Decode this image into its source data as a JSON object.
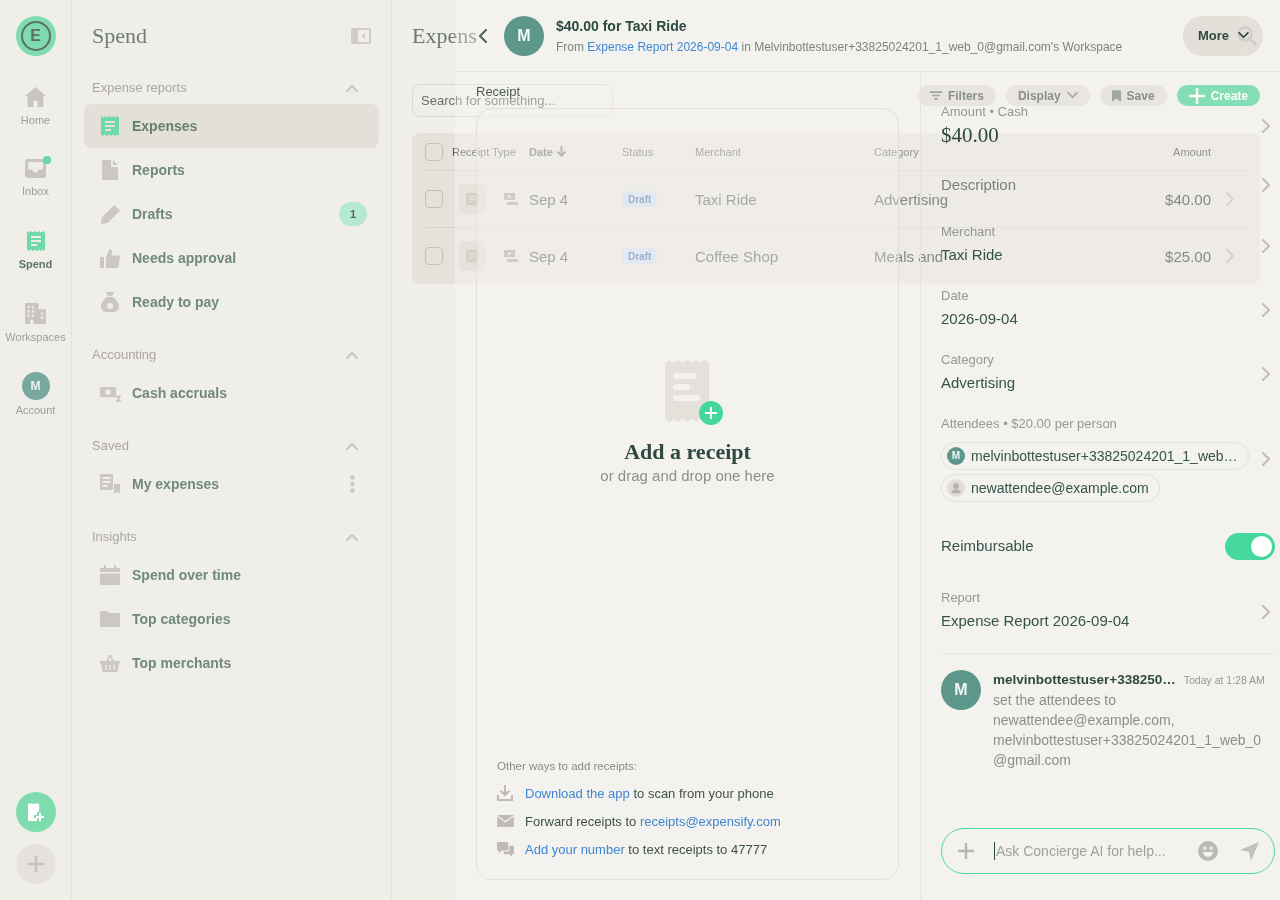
{
  "nav_rail": {
    "logo": "E",
    "items": [
      {
        "label": "Home",
        "selected": false,
        "notification": false
      },
      {
        "label": "Inbox",
        "selected": false,
        "notification": true
      },
      {
        "label": "Spend",
        "selected": true,
        "notification": false
      },
      {
        "label": "Workspaces",
        "selected": false,
        "notification": false
      },
      {
        "label": "Account",
        "selected": false,
        "notification": false,
        "avatar": "M"
      }
    ]
  },
  "sidebar": {
    "title": "Spend",
    "sections": [
      {
        "heading": "Expense reports",
        "expanded": true,
        "items": [
          {
            "label": "Expenses",
            "selected": true
          },
          {
            "label": "Reports",
            "selected": false
          },
          {
            "label": "Drafts",
            "selected": false,
            "count": "1"
          },
          {
            "label": "Needs approval",
            "selected": false
          },
          {
            "label": "Ready to pay",
            "selected": false
          }
        ]
      },
      {
        "heading": "Accounting",
        "expanded": true,
        "items": [
          {
            "label": "Cash accruals",
            "selected": false
          }
        ]
      },
      {
        "heading": "Saved",
        "expanded": true,
        "items": [
          {
            "label": "My expenses",
            "selected": false,
            "menu": true
          }
        ]
      },
      {
        "heading": "Insights",
        "expanded": true,
        "items": [
          {
            "label": "Spend over time",
            "selected": false
          },
          {
            "label": "Top categories",
            "selected": false
          },
          {
            "label": "Top merchants",
            "selected": false
          }
        ]
      }
    ]
  },
  "main": {
    "title": "Expens",
    "search": {
      "placeholder": "Search for something..."
    },
    "toolbar": [
      {
        "label": "Filters",
        "kind": "filter"
      },
      {
        "label": "Display",
        "kind": "dropdown"
      },
      {
        "label": "Save",
        "kind": "save"
      },
      {
        "label": "Create",
        "kind": "create"
      }
    ],
    "table": {
      "all_checked": false,
      "columns": [
        {
          "label": "Receipt",
          "sorted": false
        },
        {
          "label": "Type",
          "sorted": false
        },
        {
          "label": "Date",
          "sorted": true
        },
        {
          "label": "Status",
          "sorted": false
        },
        {
          "label": "Merchant",
          "sorted": false
        },
        {
          "label": "Category",
          "sorted": false
        },
        {
          "label": "Amount",
          "sorted": false
        }
      ],
      "rows": [
        {
          "checked": false,
          "date": "Sep 4",
          "status": "Draft",
          "merchant": "Taxi Ride",
          "category": "Advertising",
          "amount": "$40.00"
        },
        {
          "checked": false,
          "date": "Sep 4",
          "status": "Draft",
          "merchant": "Coffee Shop",
          "category": "Meals and",
          "amount": "$25.00"
        }
      ]
    }
  },
  "expense_panel": {
    "header": {
      "avatar": "M",
      "title": "$40.00 for Taxi Ride",
      "subtitle": {
        "before": "From",
        "link": "Expense Report 2026-09-04",
        "after": "in Melvinbottestuser+33825024201_1_web_0@gmail.com's Workspace"
      },
      "more": "More"
    },
    "receipt": {
      "label": "Receipt",
      "title": "Add a receipt",
      "hint": "or drag and drop one here",
      "other_ways_heading": "Other ways to add receipts:",
      "other_ways": [
        {
          "link": "Download the app",
          "after": "to scan from your phone"
        },
        {
          "before": "Forward receipts to",
          "link": "receipts@expensify.com"
        },
        {
          "link": "Add your number",
          "after": "to text receipts to 47777"
        }
      ]
    },
    "fields": [
      {
        "kind": "amount",
        "label": "Amount • Cash",
        "value": "$40.00"
      },
      {
        "kind": "text",
        "label": "Description"
      },
      {
        "kind": "text",
        "label": "Merchant",
        "value": "Taxi Ride"
      },
      {
        "kind": "text",
        "label": "Date",
        "value": "2026-09-04"
      },
      {
        "kind": "text",
        "label": "Category",
        "value": "Advertising"
      },
      {
        "kind": "attendees",
        "label": "Attendees • $20.00 per person",
        "attendees": [
          {
            "name": "melvinbottestuser+33825024201_1_web…",
            "avatar": "M"
          },
          {
            "name": "newattendee@example.com"
          }
        ]
      },
      {
        "kind": "toggle",
        "label": "Reimbursable",
        "on": true
      },
      {
        "kind": "text",
        "label": "Report",
        "value": "Expense Report 2026-09-04"
      }
    ],
    "comments": [
      {
        "avatar": "M",
        "author": "melvinbottestuser+338250…",
        "time": "Today at 1:28 AM",
        "message": "set the attendees to newattendee@example.com, melvinbottestuser+33825024201_1_web_0@gmail.com"
      }
    ],
    "composer": {
      "placeholder": "Ask Concierge AI for help...",
      "focused": true
    }
  }
}
